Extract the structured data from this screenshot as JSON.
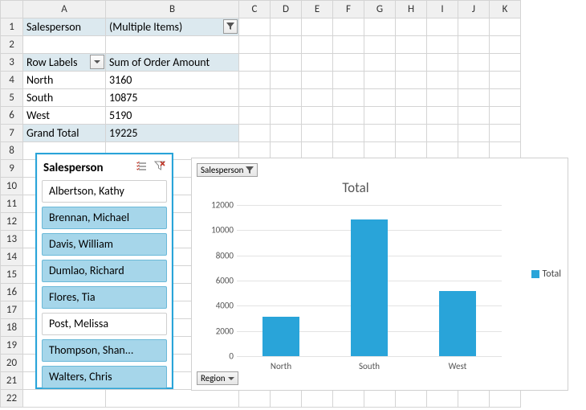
{
  "columns": [
    "A",
    "B",
    "C",
    "D",
    "E",
    "F",
    "G",
    "H",
    "I",
    "J",
    "K"
  ],
  "rows": 22,
  "pivot": {
    "filter_field": "Salesperson",
    "filter_value": "(Multiple Items)",
    "row_header": "Row Labels",
    "value_header": "Sum of Order Amount",
    "data": [
      {
        "label": "North",
        "value": "3160"
      },
      {
        "label": "South",
        "value": "10875"
      },
      {
        "label": "West",
        "value": "5190"
      }
    ],
    "grand_label": "Grand Total",
    "grand_value": "19225"
  },
  "slicer": {
    "title": "Salesperson",
    "items": [
      {
        "label": "Albertson, Kathy",
        "selected": false
      },
      {
        "label": "Brennan, Michael",
        "selected": true
      },
      {
        "label": "Davis, William",
        "selected": true
      },
      {
        "label": "Dumlao, Richard",
        "selected": true
      },
      {
        "label": "Flores, Tia",
        "selected": true
      },
      {
        "label": "Post, Melissa",
        "selected": false
      },
      {
        "label": "Thompson, Shan...",
        "selected": true
      },
      {
        "label": "Walters, Chris",
        "selected": true
      }
    ]
  },
  "chart_data": {
    "type": "bar",
    "title": "Total",
    "filter_button": "Salesperson",
    "axis_button": "Region",
    "legend": "Total",
    "categories": [
      "North",
      "South",
      "West"
    ],
    "values": [
      3160,
      10875,
      5190
    ],
    "ylim": [
      0,
      12000
    ],
    "ystep": 2000,
    "xlabel": "",
    "ylabel": ""
  },
  "colors": {
    "accent": "#29a4d9",
    "header": "#dce9ef"
  }
}
